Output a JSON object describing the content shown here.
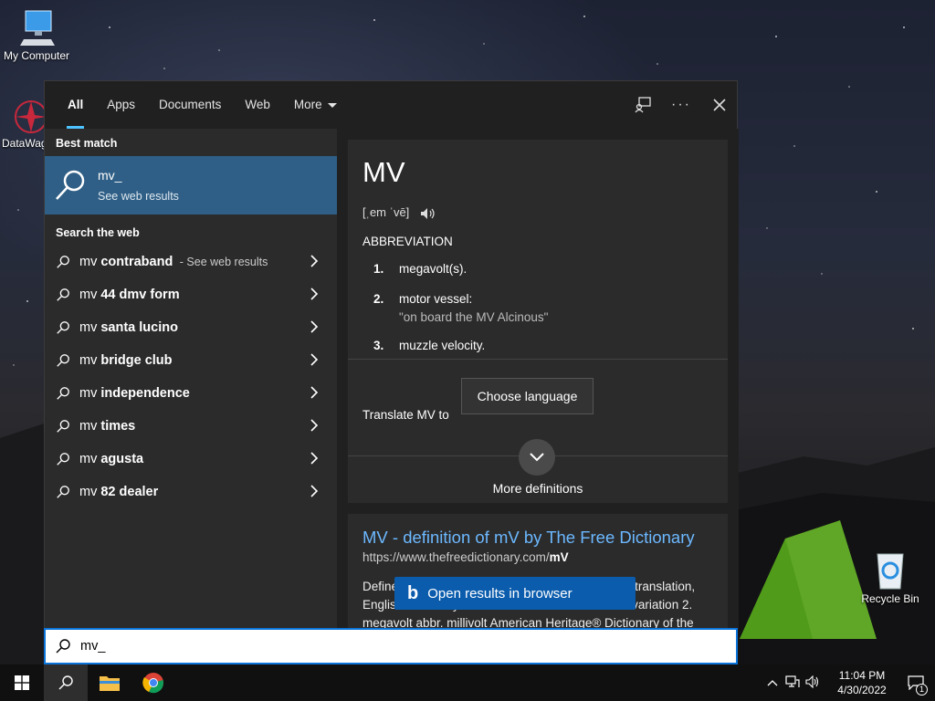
{
  "desktop": {
    "icons": [
      {
        "label": "My Computer"
      },
      {
        "label": "DataWag"
      },
      {
        "label": "Recycle Bin"
      }
    ]
  },
  "tabs": [
    "All",
    "Apps",
    "Documents",
    "Web",
    "More"
  ],
  "active_tab": "All",
  "left": {
    "best_match_title": "Best match",
    "best_match": {
      "title": "mv_",
      "subtitle": "See web results"
    },
    "search_web_title": "Search the web",
    "suggestions": [
      {
        "prefix": "mv ",
        "bold": "contraband",
        "extra": " - See web results"
      },
      {
        "prefix": "mv ",
        "bold": "44 dmv form",
        "extra": ""
      },
      {
        "prefix": "mv ",
        "bold": "santa lucino",
        "extra": ""
      },
      {
        "prefix": "mv ",
        "bold": "bridge club",
        "extra": ""
      },
      {
        "prefix": "mv ",
        "bold": "independence",
        "extra": ""
      },
      {
        "prefix": "mv ",
        "bold": "times",
        "extra": ""
      },
      {
        "prefix": "mv ",
        "bold": "agusta",
        "extra": ""
      },
      {
        "prefix": "mv ",
        "bold": "82 dealer",
        "extra": ""
      }
    ]
  },
  "dictionary": {
    "word": "MV",
    "pronunciation": "[ˌem ˈvē]",
    "part_of_speech": "ABBREVIATION",
    "definitions": [
      {
        "num": "1.",
        "text": "megavolt(s).",
        "example": ""
      },
      {
        "num": "2.",
        "text": "motor vessel:",
        "example": "\"on board the MV Alcinous\""
      },
      {
        "num": "3.",
        "text": "muzzle velocity.",
        "example": ""
      }
    ],
    "translate_label": "Translate MV to",
    "choose_language": "Choose language",
    "more_definitions": "More definitions"
  },
  "web_result": {
    "title": "MV - definition of mV by The Free Dictionary",
    "url_prefix": "https://www.thefreedictionary.com/",
    "url_bold": "mV",
    "snippet": "Define mV. mV synonyms, mV pronunciation, mV translation, English dictionary definition of mV. abbr. 1. mean variation 2. megavolt abbr. millivolt American Heritage® Dictionary of the"
  },
  "open_in_browser": "Open results in browser",
  "search": {
    "value": "mv_"
  },
  "taskbar": {
    "time": "11:04 PM",
    "date": "4/30/2022",
    "notification_count": "1"
  },
  "colors": {
    "accent": "#4cc2ff",
    "selection": "#2f5f86",
    "link": "#6cb8ff",
    "bing_button": "#0b5cad"
  }
}
